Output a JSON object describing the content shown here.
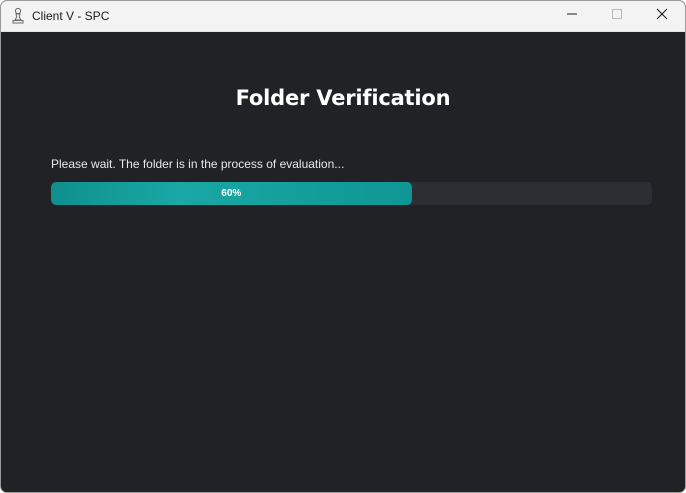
{
  "window": {
    "title": "Client V - SPC",
    "app_icon": "pawn-icon"
  },
  "title_controls": {
    "minimize_icon": "minimize-icon",
    "maximize_icon": "maximize-icon",
    "close_icon": "close-icon"
  },
  "main": {
    "heading": "Folder Verification",
    "status_text": "Please wait. The folder is in the process of evaluation...",
    "progress": {
      "value": 60,
      "label": "60%"
    }
  },
  "colors": {
    "background": "#212226",
    "progress_track": "#2d2e33",
    "progress_fill": "#15a19e",
    "text": "#ffffff"
  }
}
